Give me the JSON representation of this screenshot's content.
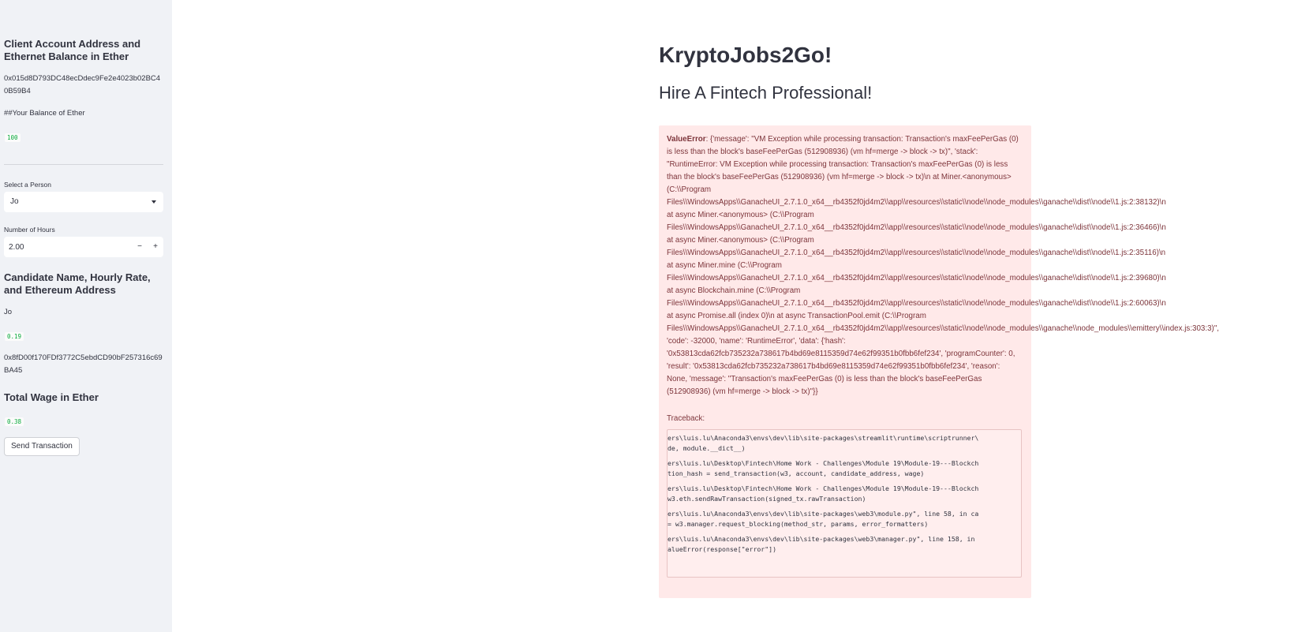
{
  "sidebar": {
    "account_heading": "Client Account Address and Ethernet Balance in Ether",
    "account_address": "0x015d8D793DC48ecDdec9Fe2e4023b02BC40B59B4",
    "balance_text": "##Your Balance of Ether",
    "balance_value": "100",
    "select_person_label": "Select a Person",
    "select_person_value": "Jo",
    "hours_label": "Number of Hours",
    "hours_value": "2.00",
    "minus_label": "−",
    "plus_label": "+",
    "candidate_heading": "Candidate Name, Hourly Rate, and Ethereum Address",
    "candidate_name": "Jo",
    "candidate_rate": "0.19",
    "candidate_address": "0x8fD00f170FDf3772C5ebdCD90bF257316c69BA45",
    "wage_heading": "Total Wage in Ether",
    "wage_value": "0.38",
    "send_button": "Send Transaction"
  },
  "main": {
    "title": "KryptoJobs2Go!",
    "subtitle": "Hire A Fintech Professional!",
    "error": {
      "label": "ValueError",
      "lines": [
        ": {'message': \"VM Exception while processing transaction: Transaction's maxFeePerGas (0)",
        "is less than the block's baseFeePerGas (512908936) (vm hf=merge -> block -> tx)\", 'stack':",
        "\"RuntimeError: VM Exception while processing transaction: Transaction's maxFeePerGas (0) is less",
        "than the block's baseFeePerGas (512908936) (vm hf=merge -> block -> tx)\\n at Miner.<anonymous>",
        "(C:\\\\Program",
        "Files\\\\WindowsApps\\\\GanacheUI_2.7.1.0_x64__rb4352f0jd4m2\\\\app\\\\resources\\\\static\\\\node\\\\node_modules\\\\ganache\\\\dist\\\\node\\\\1.js:2:38132)\\n",
        "at async Miner.<anonymous> (C:\\\\Program",
        "Files\\\\WindowsApps\\\\GanacheUI_2.7.1.0_x64__rb4352f0jd4m2\\\\app\\\\resources\\\\static\\\\node\\\\node_modules\\\\ganache\\\\dist\\\\node\\\\1.js:2:36466)\\n",
        "at async Miner.<anonymous> (C:\\\\Program",
        "Files\\\\WindowsApps\\\\GanacheUI_2.7.1.0_x64__rb4352f0jd4m2\\\\app\\\\resources\\\\static\\\\node\\\\node_modules\\\\ganache\\\\dist\\\\node\\\\1.js:2:35116)\\n",
        "at async Miner.mine (C:\\\\Program",
        "Files\\\\WindowsApps\\\\GanacheUI_2.7.1.0_x64__rb4352f0jd4m2\\\\app\\\\resources\\\\static\\\\node\\\\node_modules\\\\ganache\\\\dist\\\\node\\\\1.js:2:39680)\\n",
        "at async Blockchain.mine (C:\\\\Program",
        "Files\\\\WindowsApps\\\\GanacheUI_2.7.1.0_x64__rb4352f0jd4m2\\\\app\\\\resources\\\\static\\\\node\\\\node_modules\\\\ganache\\\\dist\\\\node\\\\1.js:2:60063)\\n",
        "at async Promise.all (index 0)\\n at async TransactionPool.emit (C:\\\\Program",
        "Files\\\\WindowsApps\\\\GanacheUI_2.7.1.0_x64__rb4352f0jd4m2\\\\app\\\\resources\\\\static\\\\node\\\\node_modules\\\\ganache\\\\node_modules\\\\emittery\\\\index.js:303:3)\",",
        "'code': -32000, 'name': 'RuntimeError', 'data': {'hash':",
        "'0x53813cda62fcb735232a738617b4bd69e8115359d74e62f99351b0fbb6fef234', 'programCounter': 0,",
        "'result': '0x53813cda62fcb735232a738617b4bd69e8115359d74e62f99351b0fbb6fef234', 'reason':",
        "None, 'message': \"Transaction's maxFeePerGas (0) is less than the block's baseFeePerGas",
        "(512908936) (vm hf=merge -> block -> tx)\"}}"
      ]
    },
    "traceback": {
      "label": "Traceback:",
      "entries": [
        [
          "ers\\luis.lu\\Anaconda3\\envs\\dev\\lib\\site-packages\\streamlit\\runtime\\scriptrunner\\",
          "de, module.__dict__)"
        ],
        [
          "ers\\luis.lu\\Desktop\\Fintech\\Home Work - Challenges\\Module 19\\Module-19---Blockch",
          "tion_hash = send_transaction(w3, account, candidate_address, wage)"
        ],
        [
          "ers\\luis.lu\\Desktop\\Fintech\\Home Work - Challenges\\Module 19\\Module-19---Blockch",
          "w3.eth.sendRawTransaction(signed_tx.rawTransaction)"
        ],
        [
          "ers\\luis.lu\\Anaconda3\\envs\\dev\\lib\\site-packages\\web3\\module.py\", line 58, in ca",
          "= w3.manager.request_blocking(method_str, params, error_formatters)"
        ],
        [
          "ers\\luis.lu\\Anaconda3\\envs\\dev\\lib\\site-packages\\web3\\manager.py\", line 158, in",
          "alueError(response[\"error\"])"
        ]
      ]
    }
  }
}
